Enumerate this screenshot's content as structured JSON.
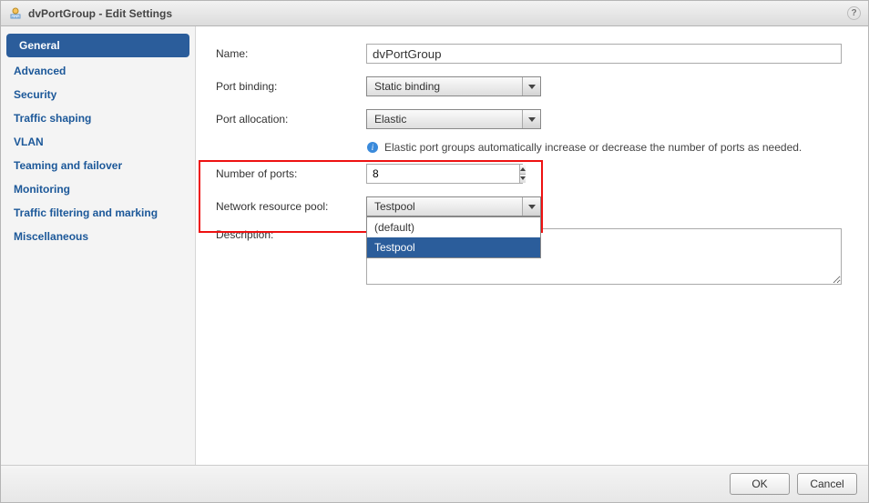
{
  "title": "dvPortGroup - Edit Settings",
  "sidebar": {
    "items": [
      {
        "label": "General",
        "active": true
      },
      {
        "label": "Advanced"
      },
      {
        "label": "Security"
      },
      {
        "label": "Traffic shaping"
      },
      {
        "label": "VLAN"
      },
      {
        "label": "Teaming and failover"
      },
      {
        "label": "Monitoring"
      },
      {
        "label": "Traffic filtering and marking"
      },
      {
        "label": "Miscellaneous"
      }
    ]
  },
  "form": {
    "name_label": "Name:",
    "name_value": "dvPortGroup",
    "port_binding_label": "Port binding:",
    "port_binding_value": "Static binding",
    "port_allocation_label": "Port allocation:",
    "port_allocation_value": "Elastic",
    "info_text": "Elastic port groups automatically increase or decrease the number of ports as needed.",
    "num_ports_label": "Number of ports:",
    "num_ports_value": "8",
    "nrp_label": "Network resource pool:",
    "nrp_value": "Testpool",
    "nrp_options": [
      {
        "label": "(default)"
      },
      {
        "label": "Testpool",
        "selected": true
      }
    ],
    "description_label": "Description:",
    "description_value": ""
  },
  "buttons": {
    "ok": "OK",
    "cancel": "Cancel"
  }
}
